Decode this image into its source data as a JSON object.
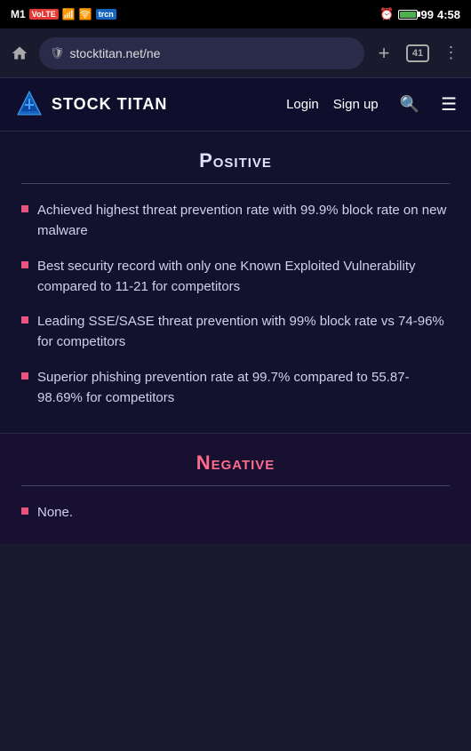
{
  "statusBar": {
    "carrier": "M1",
    "volte": "VoLTE",
    "signal": "▐▌▌",
    "wifi": "WiFi",
    "trcn": "trcn",
    "alarm": "⏰",
    "battery": "99",
    "time": "4:58"
  },
  "browser": {
    "url": "stocktitan.net/ne",
    "tabCount": "41",
    "homeLabel": "⌂",
    "plusLabel": "+",
    "menuLabel": "⋮"
  },
  "navbar": {
    "logoText": "STOCK TITAN",
    "loginLabel": "Login",
    "signupLabel": "Sign up"
  },
  "positive": {
    "title": "Positive",
    "bullets": [
      "Achieved highest threat prevention rate with 99.9% block rate on new malware",
      "Best security record with only one Known Exploited Vulnerability compared to 11-21 for competitors",
      "Leading SSE/SASE threat prevention with 99% block rate vs 74-96% for competitors",
      "Superior phishing prevention rate at 99.7% compared to 55.87-98.69% for competitors"
    ]
  },
  "negative": {
    "title": "Negative",
    "bullets": [
      "None."
    ]
  }
}
